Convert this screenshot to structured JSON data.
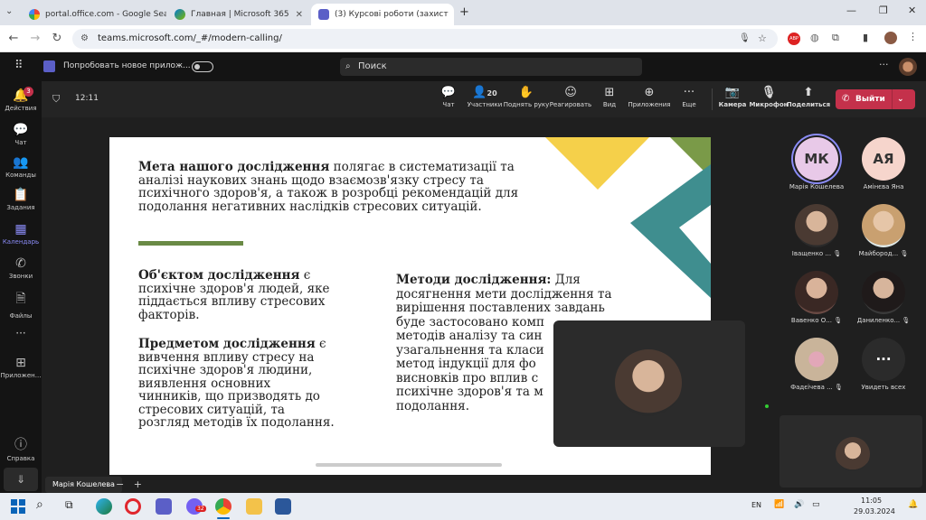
{
  "browser": {
    "tabs": [
      {
        "label": "portal.office.com - Google Sear",
        "active": false
      },
      {
        "label": "Главная | Microsoft 365",
        "active": false
      },
      {
        "label": "(3) Курсові роботи (захист",
        "active": true
      }
    ],
    "url": "teams.microsoft.com/_#/modern-calling/"
  },
  "teams": {
    "try_new": "Попробовать новое прилож...",
    "search_placeholder": "Поиск",
    "rail": [
      {
        "label": "Действия",
        "icon": "bell-icon",
        "badge": "3"
      },
      {
        "label": "Чат",
        "icon": "chat-icon"
      },
      {
        "label": "Команды",
        "icon": "teams-icon"
      },
      {
        "label": "Задания",
        "icon": "assignments-icon"
      },
      {
        "label": "Календарь",
        "icon": "calendar-icon",
        "active": true
      },
      {
        "label": "Звонки",
        "icon": "phone-icon"
      },
      {
        "label": "Файлы",
        "icon": "files-icon"
      },
      {
        "label": "Приложен...",
        "icon": "apps-icon"
      },
      {
        "label": "Справка",
        "icon": "help-icon"
      }
    ]
  },
  "meeting": {
    "timer": "12:11",
    "participants_count": "20",
    "tools": [
      {
        "label": "Чат",
        "icon": "chat-icon"
      },
      {
        "label": "Участники",
        "icon": "people-icon"
      },
      {
        "label": "Поднять руку",
        "icon": "hand-icon"
      },
      {
        "label": "Реагировать",
        "icon": "smile-icon"
      },
      {
        "label": "Вид",
        "icon": "grid-icon"
      },
      {
        "label": "Приложения",
        "icon": "plus-icon"
      },
      {
        "label": "Еще",
        "icon": "more-icon"
      },
      {
        "label": "Камера",
        "icon": "camera-off-icon"
      },
      {
        "label": "Микрофон",
        "icon": "mic-icon"
      },
      {
        "label": "Поделиться",
        "icon": "share-icon"
      }
    ],
    "leave_label": "Выйти",
    "presenter_name": "Марія Кошелева"
  },
  "slide": {
    "goal_bold": "Мета нашого дослідження",
    "goal_lines": [
      " полягає в систематизації та",
      "аналізі наукових знань щодо взаємозв'язку стресу та",
      "психічного здоров'я, а також в розробці рекомендацій для",
      "подолання негативних наслідків стресових ситуацій."
    ],
    "object_bold": "Об'єктом дослідження",
    "object_lines": [
      " є",
      "психічне здоров'я людей, яке",
      "піддається впливу стресових",
      "факторів."
    ],
    "subject_bold": "Предметом дослідження",
    "subject_lines": [
      " є",
      "вивчення впливу стресу на",
      "психічне здоров'я людини,",
      "виявлення основних",
      "чинників, що призводять до",
      "стресових ситуацій, та",
      "розгляд методів їх подолання."
    ],
    "methods_bold": "Методи дослідження:",
    "methods_lines": [
      " Для",
      "досягнення мети дослідження та",
      "вирішення поставлених завдань",
      "буде застосовано комп",
      "методів аналізу та син",
      "узагальнення та класи",
      "метод індукції для фо",
      "висновків про вплив с",
      "психічне здоров'я та м",
      "подолання."
    ],
    "colors": {
      "yellow": "#f5d04a",
      "green": "#7a9a48",
      "teal": "#3f8e8f",
      "bar": "#6a8a45"
    }
  },
  "participants": [
    {
      "name": "Марія Кошелева",
      "initials": "МК",
      "color": "#e8c9e8",
      "ring": true
    },
    {
      "name": "Амінєва Яна",
      "initials": "АЯ",
      "color": "#f6d5cc"
    },
    {
      "name": "Іващенко ...",
      "photo": true
    },
    {
      "name": "Майбород...",
      "photo": true
    },
    {
      "name": "Вавенко О...",
      "photo": true
    },
    {
      "name": "Даниленко...",
      "photo": true
    },
    {
      "name": "Фадєічева ...",
      "photo": true
    },
    {
      "name": "Увидеть всех",
      "more": true
    }
  ],
  "taskbar": {
    "lang": "EN",
    "time": "11:05",
    "date": "29.03.2024",
    "badge": "32"
  }
}
